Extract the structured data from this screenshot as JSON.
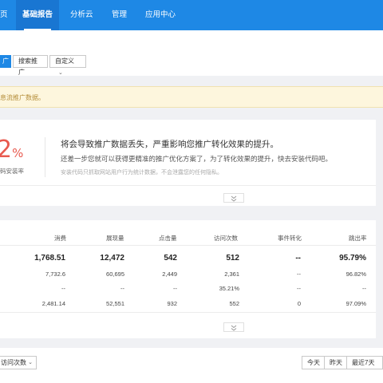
{
  "nav": {
    "tabs": [
      {
        "label": "页"
      },
      {
        "label": "基础报告"
      },
      {
        "label": "分析云"
      },
      {
        "label": "管理"
      },
      {
        "label": "应用中心"
      }
    ]
  },
  "toolbar": {
    "segments": [
      {
        "label": "广"
      },
      {
        "label": "搜索推广"
      },
      {
        "label": "自定义"
      }
    ]
  },
  "notice": {
    "text": "息流推广数据。"
  },
  "install_card": {
    "rate_value": "2",
    "rate_unit": "%",
    "rate_label": "码安装率",
    "line1": "将会导致推广数据丢失，严重影响您推广转化效果的提升。",
    "line2": "还差一步您就可以获得更精准的推广优化方案了，为了转化效果的提升，快去安装代码吧。",
    "line3": "安装代码只抓取网站用户行为统计数据，不会泄露您的任何隐私。"
  },
  "metrics": {
    "headers": [
      "消费",
      "展现量",
      "点击量",
      "访问次数",
      "事件转化",
      "跳出率"
    ],
    "rows": [
      [
        "1,768.51",
        "12,472",
        "542",
        "512",
        "--",
        "95.79%"
      ],
      [
        "7,732.6",
        "60,695",
        "2,449",
        "2,361",
        "--",
        "96.82%"
      ],
      [
        "--",
        "--",
        "--",
        "35.21%",
        "--",
        "--"
      ],
      [
        "2,481.14",
        "52,551",
        "932",
        "552",
        "0",
        "97.09%"
      ]
    ]
  },
  "footer": {
    "select_value": "访问次数",
    "range_buttons": [
      {
        "label": "今天"
      },
      {
        "label": "昨天"
      },
      {
        "label": "最近7天"
      }
    ]
  },
  "colors": {
    "nav_bg": "#1e88e5",
    "accent": "#1e88e5",
    "alert_red": "#e85a4f",
    "notice_bg": "#fdf6dd",
    "notice_text": "#b58e3a"
  }
}
